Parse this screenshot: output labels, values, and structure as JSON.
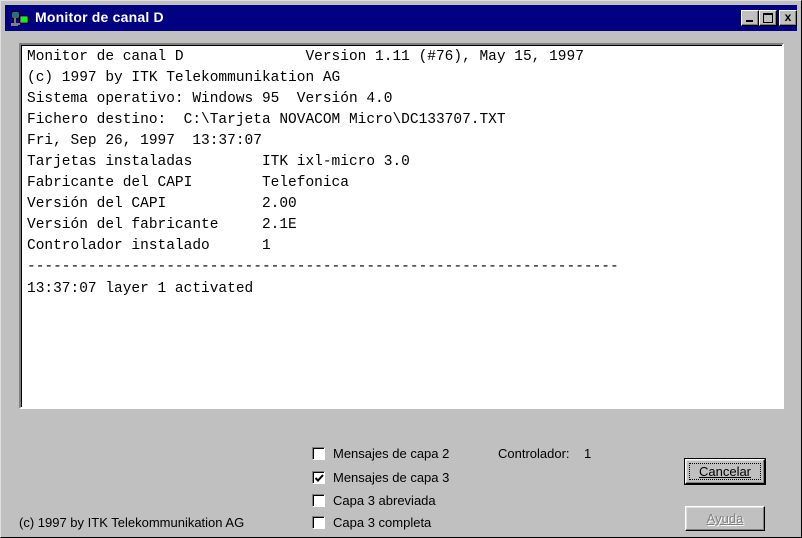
{
  "window": {
    "title": "Monitor de canal D",
    "minimize_label": "_",
    "close_label": "x"
  },
  "log": {
    "lines": [
      "Monitor de canal D              Version 1.11 (#76), May 15, 1997",
      "(c) 1997 by ITK Telekommunikation AG",
      "Sistema operativo: Windows 95  Versión 4.0",
      "Fichero destino:  C:\\Tarjeta NOVACOM Micro\\DC133707.TXT",
      "Fri, Sep 26, 1997  13:37:07",
      "Tarjetas instaladas        ITK ixl-micro 3.0",
      "Fabricante del CAPI        Telefonica",
      "Versión del CAPI           2.00",
      "Versión del fabricante     2.1E",
      "Controlador instalado      1",
      "--------------------------------------------------------------------",
      "13:37:07 layer 1 activated"
    ]
  },
  "options": [
    {
      "label": "Mensajes de capa 2",
      "checked": false
    },
    {
      "label": "Mensajes de capa 3",
      "checked": true
    },
    {
      "label": "Capa 3 abreviada",
      "checked": false
    },
    {
      "label": "Capa 3 completa",
      "checked": false
    }
  ],
  "controller": {
    "label": "Controlador:",
    "value": "1"
  },
  "buttons": {
    "cancel": "Cancelar",
    "help": "Ayuda"
  },
  "footer": {
    "copyright": "(c) 1997 by ITK Telekommunikation AG"
  }
}
